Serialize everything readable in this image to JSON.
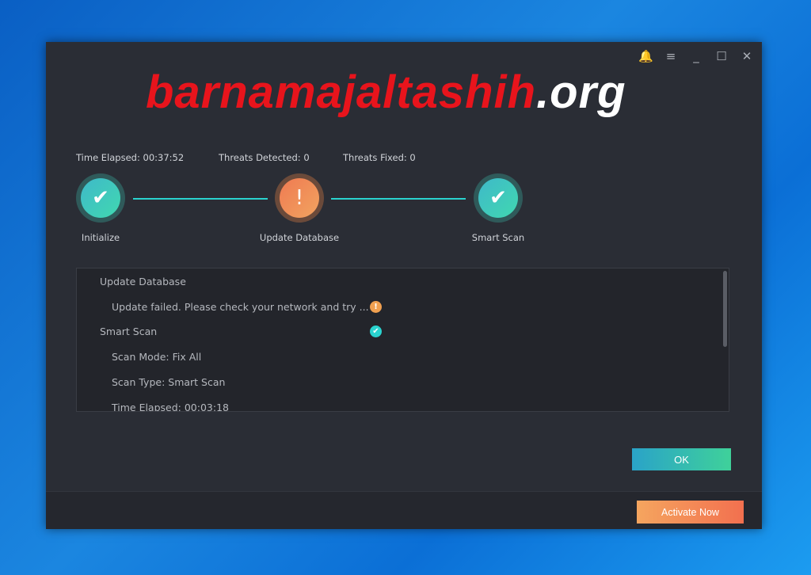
{
  "watermark": {
    "red": "barnamajaltashih",
    "white": ".org"
  },
  "window_controls": [
    {
      "icon": "bell-icon",
      "glyph": "🔔"
    },
    {
      "icon": "menu-icon",
      "glyph": "≡"
    },
    {
      "icon": "minimize-icon",
      "glyph": "_"
    },
    {
      "icon": "maximize-icon",
      "glyph": "☐"
    },
    {
      "icon": "close-icon",
      "glyph": "✕"
    }
  ],
  "stats": {
    "time_elapsed": "Time Elapsed: 00:37:52",
    "threats_detected": "Threats Detected: 0",
    "threats_fixed": "Threats Fixed: 0"
  },
  "steps": [
    {
      "label": "Initialize",
      "status": "success",
      "glyph": "✔"
    },
    {
      "label": "Update Database",
      "status": "warning",
      "glyph": "!"
    },
    {
      "label": "Smart Scan",
      "status": "success",
      "glyph": "✔"
    }
  ],
  "log": [
    {
      "text": "Update Database",
      "indent": false
    },
    {
      "text": "Update failed. Please check your network and try ...",
      "indent": true,
      "status": "warning",
      "glyph": "!"
    },
    {
      "text": "Smart Scan",
      "indent": false,
      "status": "success",
      "glyph": "✔"
    },
    {
      "text": "Scan Mode: Fix All",
      "indent": true
    },
    {
      "text": "Scan Type: Smart Scan",
      "indent": true
    },
    {
      "text": "Time Elapsed: 00:03:18",
      "indent": true
    }
  ],
  "ok_label": "OK",
  "activate_label": "Activate Now",
  "colors": {
    "accent": "#2ad3cf",
    "warning": "#f0a050",
    "activate": "#f2704f"
  }
}
